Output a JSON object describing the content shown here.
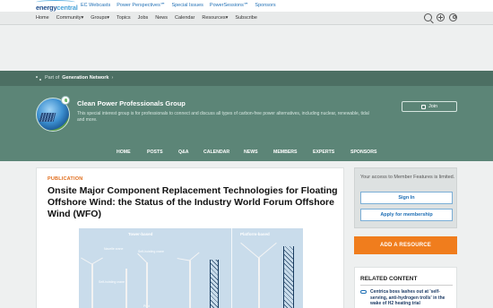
{
  "brand": {
    "logo_text_a": "energy",
    "logo_text_b": "central"
  },
  "top_links": [
    "EC Webcasts",
    "Power Perspectives℠",
    "Special Issues",
    "PowerSessions℠",
    "Sponsors"
  ],
  "nav": {
    "items": [
      "Home",
      "Community▾",
      "Groups▾",
      "Topics",
      "Jobs",
      "News",
      "Calendar",
      "Resources▾",
      "Subscribe"
    ],
    "icons": [
      "search-icon",
      "plus-icon",
      "user-icon"
    ]
  },
  "network": {
    "prefix": "Part of",
    "name": "Generation Network",
    "suffix": "›"
  },
  "group": {
    "title": "Clean Power Professionals Group",
    "description": "This special interest group is for professionals to connect and discuss all types of carbon-free power alternatives, including nuclear, renewable, tidal and more.",
    "join_label": "Join",
    "tabs": [
      "HOME",
      "POSTS",
      "Q&A",
      "CALENDAR",
      "NEWS",
      "MEMBERS",
      "EXPERTS",
      "SPONSORS"
    ]
  },
  "article": {
    "kicker": "PUBLICATION",
    "title": "Onsite Major Component Replacement Technologies for Floating Offshore Wind: the Status of the Industry World Forum Offshore Wind (WFO)",
    "figure": {
      "left_caption": "Tower-based",
      "right_caption": "Platform-based",
      "labels": [
        "Nacelle crane",
        "Self-hoisting crane",
        "Self-hoisting crane",
        "Pilot"
      ]
    }
  },
  "sidebar": {
    "access_text": "Your access to Member Features is limited.",
    "sign_in_label": "Sign In",
    "apply_label": "Apply for membership",
    "resource_label": "ADD A RESOURCE",
    "related_heading": "RELATED CONTENT",
    "related_items": [
      "Centrica boss lashes out at 'self-serving, anti-hydrogen trolls' in the wake of H2 heating trial"
    ]
  }
}
